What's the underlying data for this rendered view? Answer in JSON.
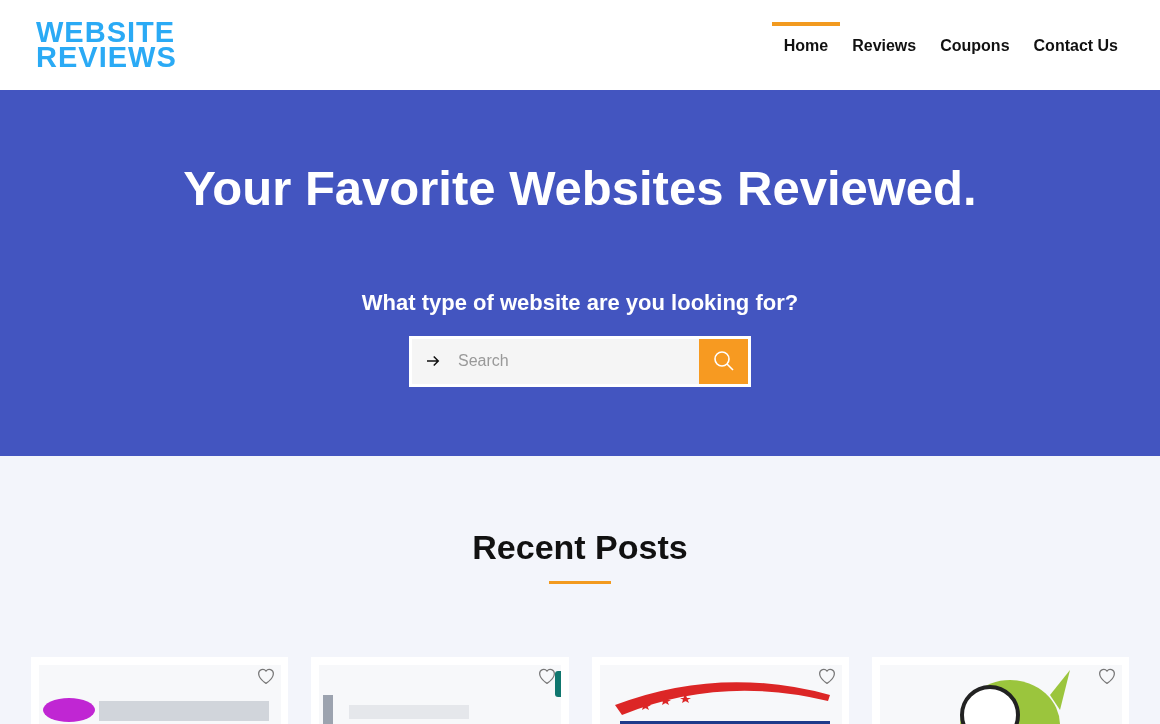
{
  "logo": {
    "lines": [
      "WEBSITE",
      "REVIEWS"
    ]
  },
  "nav": [
    {
      "label": "Home",
      "selected": true
    },
    {
      "label": "Reviews",
      "selected": false
    },
    {
      "label": "Coupons",
      "selected": false
    },
    {
      "label": "Contact Us",
      "selected": false
    }
  ],
  "hero": {
    "title": "Your Favorite Websites Reviewed.",
    "subtitle": "What type of website are you looking for?",
    "search": {
      "placeholder": "Search"
    }
  },
  "recent_posts": {
    "title": "Recent Posts"
  }
}
